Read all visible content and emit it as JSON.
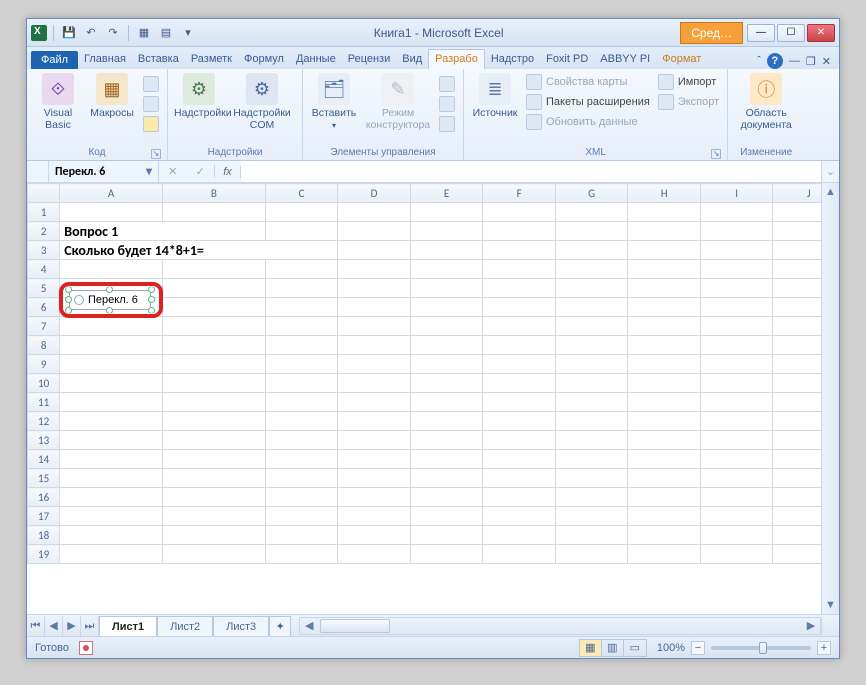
{
  "title": "Книга1 - Microsoft Excel",
  "titlebar_extra": "Сред…",
  "tabs": {
    "file": "Файл",
    "items": [
      "Главная",
      "Вставка",
      "Разметк",
      "Формул",
      "Данные",
      "Рецензи",
      "Вид",
      "Разрабо",
      "Надстро",
      "Foxit PD",
      "ABBYY PI",
      "Формат"
    ],
    "active_index": 7
  },
  "ribbon": {
    "code": {
      "label": "Код",
      "visual_basic": "Visual Basic",
      "macros": "Макросы"
    },
    "addins": {
      "label": "Надстройки",
      "addins_btn": "Надстройки",
      "com": "Надстройки COM"
    },
    "controls": {
      "label": "Элементы управления",
      "insert": "Вставить",
      "design": "Режим конструктора"
    },
    "xml": {
      "label": "XML",
      "source": "Источник",
      "map_props": "Свойства карты",
      "expansion": "Пакеты расширения",
      "refresh": "Обновить данные",
      "import": "Импорт",
      "export": "Экспорт"
    },
    "document": {
      "label": "Изменение",
      "panel": "Область документа"
    }
  },
  "namebox": "Перекл. 6",
  "formula": "",
  "columns": [
    "A",
    "B",
    "C",
    "D",
    "E",
    "F",
    "G",
    "H",
    "I",
    "J"
  ],
  "rows": {
    "r2": "Вопрос 1",
    "r3": "Сколько будет 14*8+1="
  },
  "control_label": "Перекл. 6",
  "sheets": {
    "items": [
      "Лист1",
      "Лист2",
      "Лист3"
    ],
    "active": 0
  },
  "status": {
    "ready": "Готово",
    "zoom": "100%"
  }
}
